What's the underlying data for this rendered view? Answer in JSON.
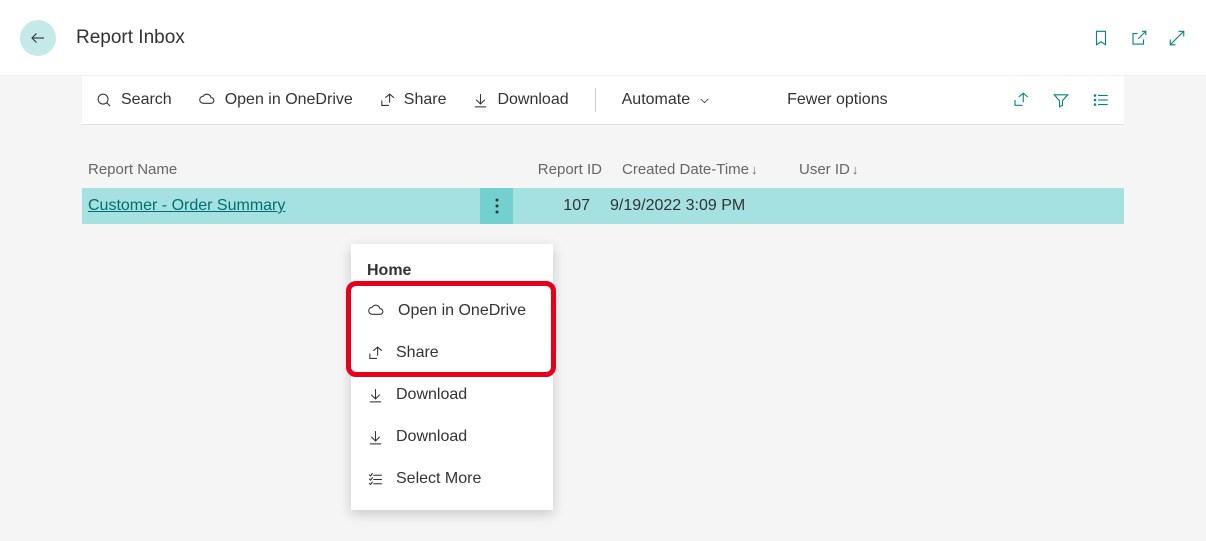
{
  "header": {
    "title": "Report Inbox"
  },
  "toolbar": {
    "search": "Search",
    "onedrive": "Open in OneDrive",
    "share": "Share",
    "download": "Download",
    "automate": "Automate",
    "fewer": "Fewer options"
  },
  "table": {
    "columns": {
      "name": "Report Name",
      "id": "Report ID",
      "date": "Created Date-Time",
      "user": "User ID"
    },
    "row": {
      "name": "Customer - Order Summary",
      "id": "107",
      "date": "9/19/2022 3:09 PM"
    }
  },
  "ctx": {
    "header": "Home",
    "onedrive": "Open in OneDrive",
    "share": "Share",
    "download1": "Download",
    "download2": "Download",
    "select_more": "Select More"
  }
}
